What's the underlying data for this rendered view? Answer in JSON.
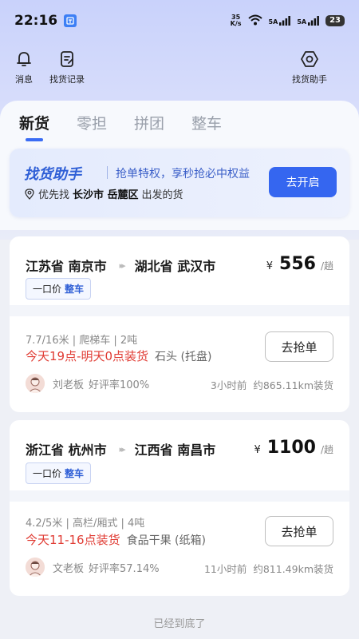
{
  "status_bar": {
    "time": "22:16",
    "net_speed_top": "35",
    "net_speed_bottom": "K/s",
    "sim1": "5A",
    "sim2": "5A",
    "battery": "23"
  },
  "header": {
    "messages_label": "消息",
    "history_label": "找货记录",
    "assistant_label": "找货助手"
  },
  "tabs": [
    "新货",
    "零担",
    "拼团",
    "整车"
  ],
  "helper": {
    "title": "找货助手",
    "promo": "抢单特权，享秒抢必中权益",
    "loc_prefix": "优先找",
    "loc_city": "长沙市 岳麓区",
    "loc_suffix": "出发的货",
    "button": "去开启"
  },
  "cargo": [
    {
      "from": "江苏省 南京市",
      "to": "湖北省 武汉市",
      "currency": "¥",
      "price": "556",
      "unit": "/趟",
      "tag_prefix": "一口价",
      "tag_type": "整车",
      "spec": "7.7/16米 | 爬梯车 | 2吨",
      "load_time": "今天19点-明天0点装货",
      "goods": "石头 (托盘)",
      "button": "去抢单",
      "owner": "刘老板",
      "rating": "好评率100%",
      "posted": "3小时前",
      "distance": "约865.11km装货"
    },
    {
      "from": "浙江省 杭州市",
      "to": "江西省 南昌市",
      "currency": "¥",
      "price": "1100",
      "unit": "/趟",
      "tag_prefix": "一口价",
      "tag_type": "整车",
      "spec": "4.2/5米 | 高栏/厢式 | 4吨",
      "load_time": "今天11-16点装货",
      "goods": "食品干果 (纸箱)",
      "button": "去抢单",
      "owner": "文老板",
      "rating": "好评率57.14%",
      "posted": "11小时前",
      "distance": "约811.49km装货"
    }
  ],
  "footer": "已经到底了",
  "colors": {
    "accent": "#3566f0",
    "time_red": "#e03b33",
    "helper_title": "#2f5fd6"
  }
}
